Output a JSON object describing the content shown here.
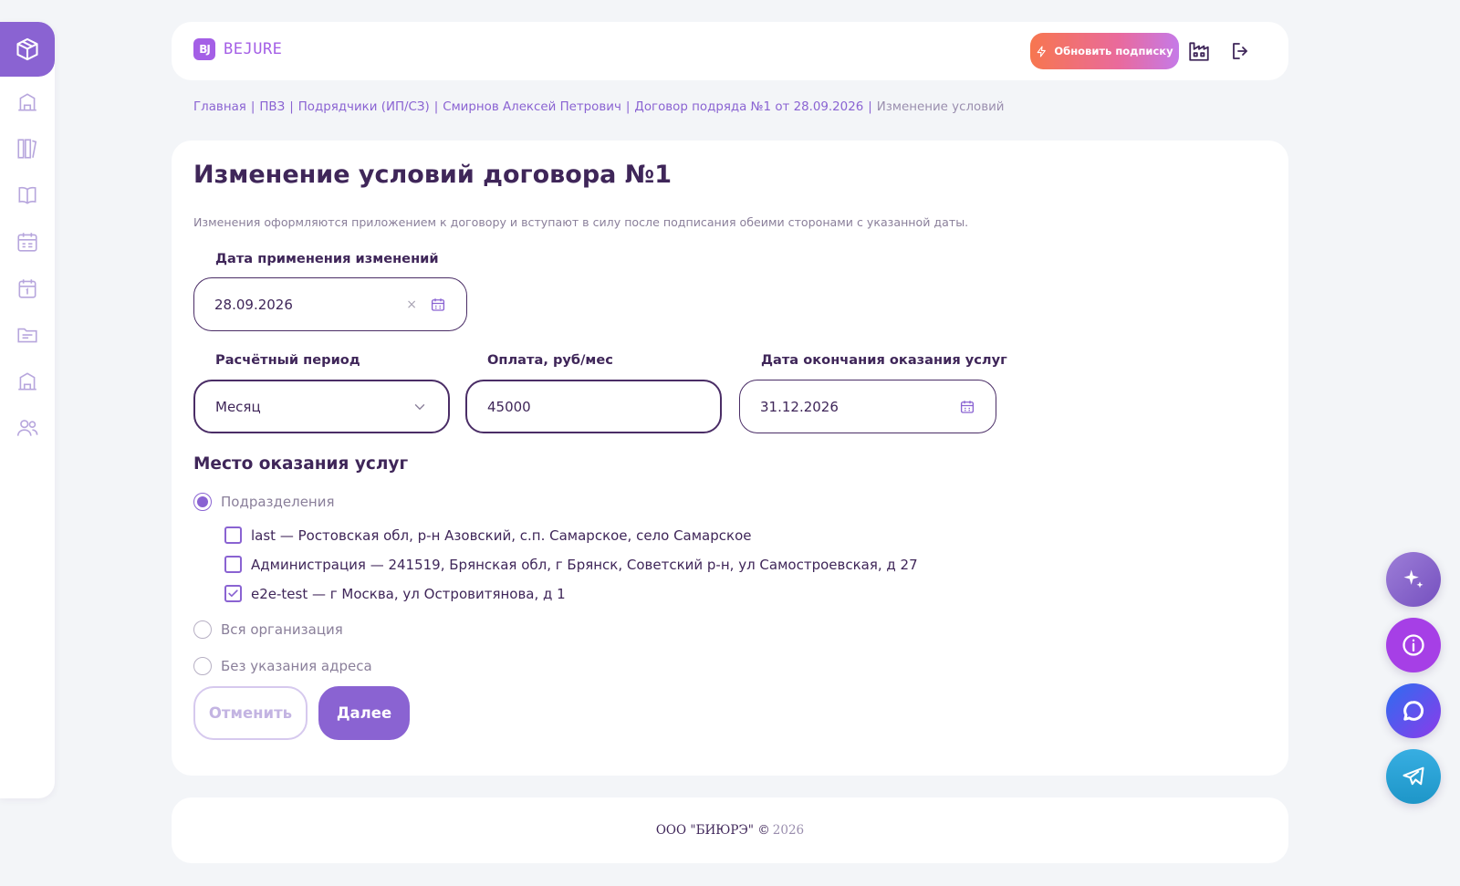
{
  "app": {
    "logo_mark": "BJ",
    "logo_text": "BEJURE"
  },
  "header": {
    "upgrade_label": "Обновить подписку"
  },
  "breadcrumb": {
    "items": [
      "Главная",
      "ПВЗ",
      "Подрядчики (ИП/СЗ)",
      "Смирнов Алексей Петрович",
      "Договор подряда №1 от 28.09.2026"
    ],
    "current": "Изменение условий",
    "separator": "|"
  },
  "page": {
    "title": "Изменение условий договора №1",
    "subtitle": "Изменения оформляются приложением к договору и вступают в силу после подписания обеими сторонами с указанной даты."
  },
  "form": {
    "apply_date": {
      "label": "Дата применения изменений",
      "value": "28.09.2026",
      "clear": "×"
    },
    "period": {
      "label": "Расчётный период",
      "value": "Месяц"
    },
    "payment": {
      "label": "Оплата, руб/мес",
      "value": "45000"
    },
    "end_date": {
      "label": "Дата окончания оказания услуг",
      "value": "31.12.2026"
    },
    "location": {
      "title": "Место оказания услуг",
      "options": [
        {
          "label": "Подразделения",
          "checked": true
        },
        {
          "label": "Вся организация",
          "checked": false
        },
        {
          "label": "Без указания адреса",
          "checked": false
        }
      ],
      "units": [
        {
          "label": "last — Ростовская обл, р-н Азовский, с.п. Самарское, село Самарское",
          "checked": false
        },
        {
          "label": "Администрация — 241519, Брянская обл, г Брянск, Советский р-н, ул Самостроевская, д 27",
          "checked": false
        },
        {
          "label": "e2e-test — г Москва, ул Островитянова, д 1",
          "checked": true
        }
      ]
    },
    "cancel_label": "Отменить",
    "next_label": "Далее"
  },
  "footer": {
    "company": "ООО \"БИЮРЭ\" ©",
    "year": "2026"
  },
  "colors": {
    "accent": "#8a63d2",
    "dark": "#3f2659",
    "upgrade_gradient_start": "#f7764f",
    "upgrade_gradient_end": "#c57ae8"
  },
  "icons": {
    "sidebar": [
      "box-icon",
      "building-icon",
      "library-icon",
      "book-icon",
      "schedule-icon",
      "calendar-icon",
      "folder-icon",
      "warehouse-icon",
      "users-icon"
    ],
    "fabs": [
      "sparkle-icon",
      "info-icon",
      "chat-icon",
      "telegram-icon"
    ]
  }
}
